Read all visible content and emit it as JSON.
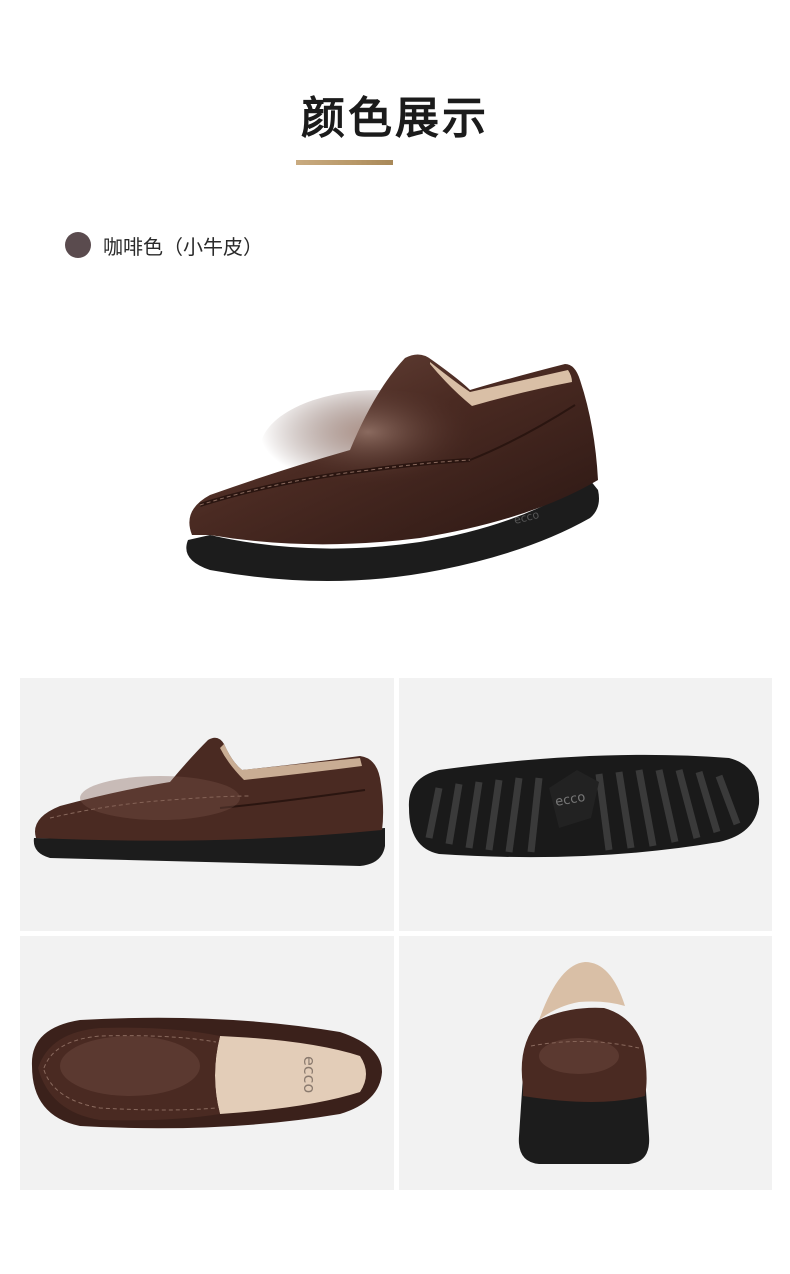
{
  "section_title": "颜色展示",
  "colors": [
    {
      "name": "咖啡色（小牛皮）",
      "swatch": "#5a4b4e"
    }
  ],
  "sole_logo": "ecco",
  "insole_logo": "ecco",
  "palette": {
    "leather": "#4a2a22",
    "sole": "#1c1c1c",
    "lining": "#d9bfa6",
    "tile_bg": "#f2f2f2",
    "accent_bar": "#c9ab80"
  }
}
